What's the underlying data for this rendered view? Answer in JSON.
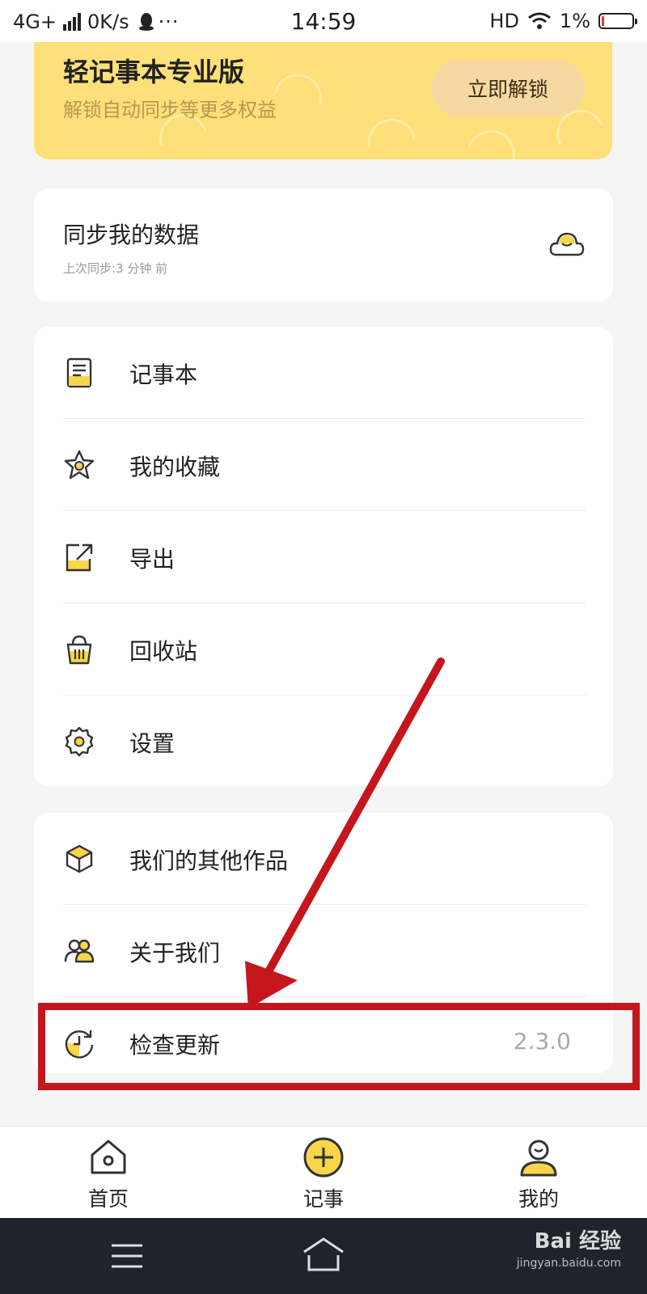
{
  "status_bar": {
    "network": "4G+",
    "speed": "0K/s",
    "time": "14:59",
    "hd": "HD",
    "battery": "1%"
  },
  "pro_banner": {
    "title": "轻记事本专业版",
    "subtitle": "解锁自动同步等更多权益",
    "unlock_label": "立即解锁"
  },
  "sync": {
    "title": "同步我的数据",
    "last_sync": "上次同步:3 分钟 前"
  },
  "menu_main": [
    {
      "label": "记事本",
      "icon": "notebook-icon"
    },
    {
      "label": "我的收藏",
      "icon": "star-icon"
    },
    {
      "label": "导出",
      "icon": "export-icon"
    },
    {
      "label": "回收站",
      "icon": "trash-icon"
    },
    {
      "label": "设置",
      "icon": "gear-icon"
    }
  ],
  "menu_more": [
    {
      "label": "我们的其他作品",
      "icon": "cube-icon"
    },
    {
      "label": "关于我们",
      "icon": "people-icon"
    },
    {
      "label": "检查更新",
      "icon": "refresh-clock-icon",
      "value": "2.3.0"
    }
  ],
  "tabbar": {
    "home": "首页",
    "note": "记事",
    "mine": "我的"
  },
  "watermark": {
    "brand": "Bai 经验",
    "url": "jingyan.baidu.com"
  },
  "colors": {
    "accent_yellow": "#fde07a",
    "icon_yellow": "#f8d54a",
    "annotation_red": "#c4161c",
    "navbar": "#1f242c"
  }
}
